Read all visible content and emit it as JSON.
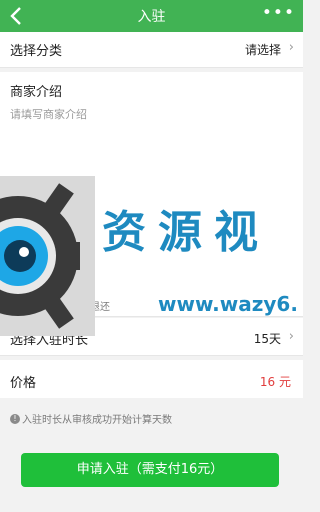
{
  "header": {
    "title": "入驻",
    "more_label": "•••"
  },
  "category": {
    "label": "选择分类",
    "value": "请选择"
  },
  "intro": {
    "label": "商家介绍",
    "placeholder": "请填写商家介绍"
  },
  "notice": "入驻缴纳的费用不退还",
  "duration": {
    "label": "选择入驻时长",
    "value": "15天"
  },
  "price": {
    "label": "价格",
    "value": "16 元"
  },
  "tip": {
    "icon": "!",
    "text": "入驻时长从审核成功开始计算天数"
  },
  "apply_button": "申请入驻（需支付16元）",
  "watermark": {
    "text": "资源视",
    "url": "www.wazy6."
  },
  "colors": {
    "header_bg": "#41b354",
    "button_bg": "#1fbf3a",
    "price_red": "#e13c3c",
    "watermark_blue": "#1e8ac0"
  }
}
